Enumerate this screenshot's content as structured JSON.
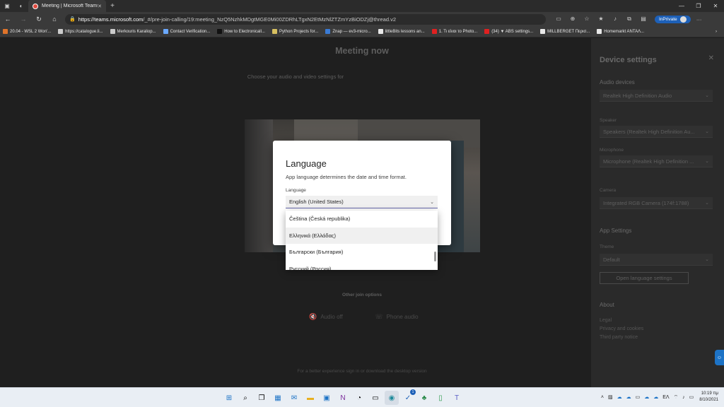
{
  "browser": {
    "tab_title": "Meeting | Microsoft Teams",
    "url_host": "https://teams.microsoft.com",
    "url_rest": "/_#/pre-join-calling/19:meeting_NzQ5NzhkMDgtMGE0Mi00ZDRhLTgxN2EtMzNlZTZmYzBiODZj@thread.v2",
    "inprivate_label": "InPrivate"
  },
  "bookmarks": [
    {
      "label": "20.04 - WSL 2 Won'...",
      "color": "#e0742a"
    },
    {
      "label": "https://catalogue.li...",
      "color": "#cccccc"
    },
    {
      "label": "Merkouris Karaliop...",
      "color": "#cccccc"
    },
    {
      "label": "Contact Verification...",
      "color": "#6aa8ff"
    },
    {
      "label": "How to Electronicall...",
      "color": "#111111"
    },
    {
      "label": "Python Projects for...",
      "color": "#d8c060"
    },
    {
      "label": "Znap — ev3-micro...",
      "color": "#3a7bd5"
    },
    {
      "label": "littleBits lessons an...",
      "color": "#e8e8e8"
    },
    {
      "label": "1. Τι είναι το Photo...",
      "color": "#e02020"
    },
    {
      "label": "(34) ▼ ABS settings...",
      "color": "#e02020"
    },
    {
      "label": "MILLBERGET Περισ...",
      "color": "#e8e8e8"
    },
    {
      "label": "Homemarkt ANTAΛ...",
      "color": "#e8e8e8"
    }
  ],
  "prejoin": {
    "subtitle": "Choose your audio and video settings for",
    "title": "Meeting now",
    "other_options": "Other join options",
    "audio_off": "Audio off",
    "phone_audio": "Phone audio",
    "footnote": "For a better experience sign in or download the desktop version"
  },
  "device_settings": {
    "title": "Device settings",
    "audio_devices": "Audio devices",
    "audio_device_value": "Realtek High Definition Audio",
    "speaker_label": "Speaker",
    "speaker_value": "Speakers (Realtek High Definition Au...",
    "microphone_label": "Microphone",
    "microphone_value": "Microphone (Realtek High Definition ...",
    "camera_label": "Camera",
    "camera_value": "Integrated RGB Camera (174f:1788)",
    "app_settings": "App Settings",
    "theme_label": "Theme",
    "theme_value": "Default",
    "open_language_button": "Open language settings",
    "about": "About",
    "legal": "Legal",
    "privacy": "Privacy and cookies",
    "third_party": "Third party notice"
  },
  "language_dialog": {
    "title": "Language",
    "description": "App language determines the date and time format.",
    "field_label": "Language",
    "selected": "English (United States)",
    "options": [
      "Čeština (Česká republika)",
      "Ελληνικά (Ελλάδας)",
      "Български (България)",
      "Русский (Россия)"
    ]
  },
  "taskbar": {
    "tray_lang": "ΕΛ",
    "time": "10:19 πμ",
    "date": "8/10/2021",
    "badge_count": "1"
  }
}
